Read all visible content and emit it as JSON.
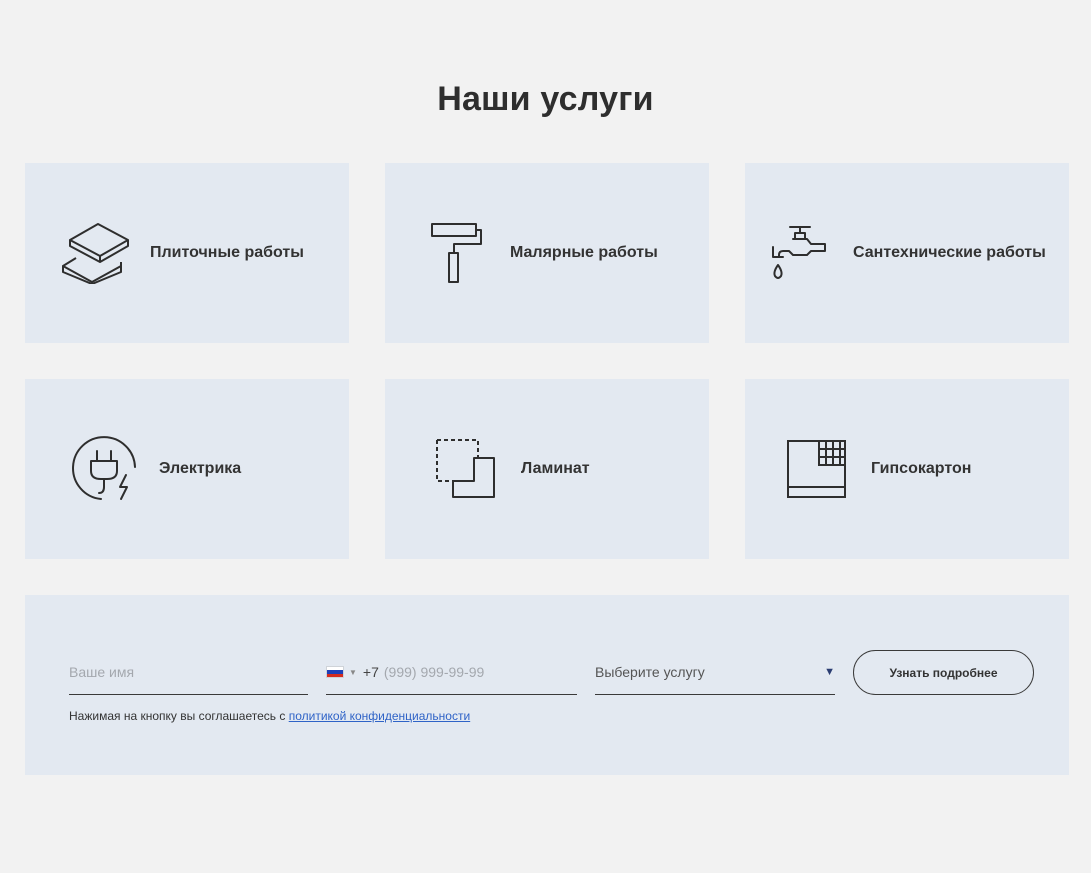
{
  "section": {
    "title": "Наши услуги"
  },
  "services": [
    {
      "label": "Плиточные работы",
      "icon": "tiles-icon"
    },
    {
      "label": "Малярные работы",
      "icon": "paint-roller-icon"
    },
    {
      "label": "Сантехнические работы",
      "icon": "faucet-icon"
    },
    {
      "label": "Электрика",
      "icon": "electric-plug-icon"
    },
    {
      "label": "Ламинат",
      "icon": "laminate-icon"
    },
    {
      "label": "Гипсокартон",
      "icon": "drywall-icon"
    }
  ],
  "form": {
    "name_placeholder": "Ваше имя",
    "phone_country": "RU",
    "phone_code": "+7",
    "phone_placeholder": "(999) 999-99-99",
    "service_select": "Выберите услугу",
    "submit_label": "Узнать подробнее",
    "consent_text": "Нажимая на кнопку вы соглашаетесь с ",
    "consent_link": "политикой конфиденциальности"
  },
  "colors": {
    "background": "#f2f2f2",
    "card": "#e3e9f1",
    "text": "#2e2e2e",
    "link": "#2f63c7",
    "select_arrow": "#2b3d72"
  }
}
